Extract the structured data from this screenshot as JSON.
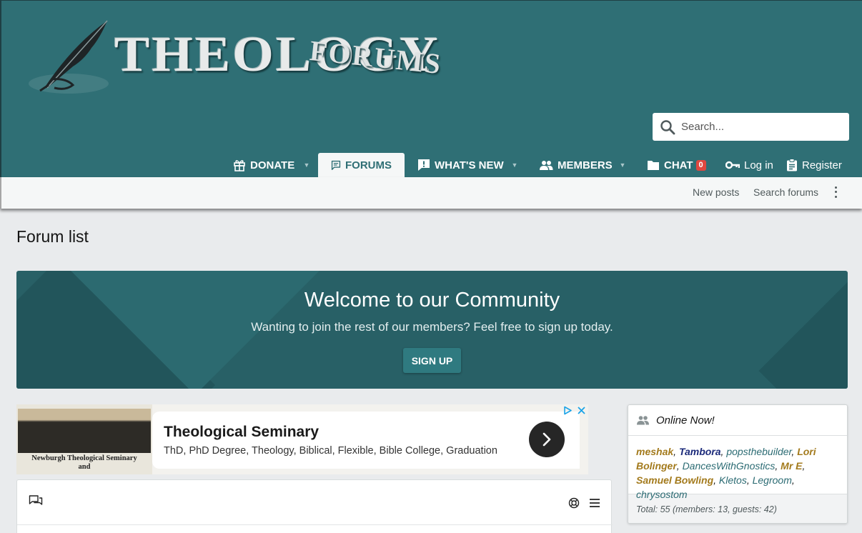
{
  "logo": {
    "main_text": "THEOLOGY",
    "secondary_text": "FORUMS"
  },
  "search": {
    "placeholder": "Search..."
  },
  "nav": {
    "donate": "DONATE",
    "forums": "FORUMS",
    "whats_new": "WHAT'S NEW",
    "members": "MEMBERS",
    "chat": "CHAT",
    "chat_badge": "0",
    "login": "Log in",
    "register": "Register"
  },
  "subnav": {
    "new_posts": "New posts",
    "search_forums": "Search forums"
  },
  "page": {
    "title": "Forum list"
  },
  "banner": {
    "title": "Welcome to our Community",
    "subtitle": "Wanting to join the rest of our members? Feel free to sign up today.",
    "button": "SIGN UP"
  },
  "ad": {
    "photo_caption_line1": "Newburgh Theological Seminary",
    "photo_caption_line2": "and",
    "title": "Theological Seminary",
    "description": "ThD, PhD Degree, Theology, Biblical, Flexible, Bible College, Graduation"
  },
  "online": {
    "title": "Online Now!",
    "users": [
      {
        "name": "meshak",
        "style": "gold"
      },
      {
        "name": "Tambora",
        "style": "navy"
      },
      {
        "name": "popsthebuilder",
        "style": "teal"
      },
      {
        "name": "Lori Bolinger",
        "style": "gold"
      },
      {
        "name": "DancesWithGnostics",
        "style": "teal"
      },
      {
        "name": "Mr E",
        "style": "gold"
      },
      {
        "name": "Samuel Bowling",
        "style": "gold"
      },
      {
        "name": "Kletos",
        "style": "teal"
      },
      {
        "name": "Legroom",
        "style": "teal"
      },
      {
        "name": "chrysostom",
        "style": "teal"
      }
    ],
    "separator": ", ",
    "total": "Total: 55 (members: 13, guests: 42)"
  },
  "colors": {
    "header": "#2f6f75",
    "banner": "#286066",
    "accent_gold": "#a37a1c",
    "accent_navy": "#1b2a7a",
    "link_teal": "#2b6b73",
    "badge": "#e0473f"
  },
  "icons": [
    "quill-icon",
    "search-icon",
    "gift-icon",
    "comment-icon",
    "alert-comment-icon",
    "members-icon",
    "folder-icon",
    "key-icon",
    "clipboard-icon",
    "more-vertical-icon",
    "ad-choices-icon",
    "ad-close-icon",
    "chevron-right-icon",
    "comments-icon",
    "lifebuoy-icon",
    "menu-icon",
    "users-icon"
  ]
}
